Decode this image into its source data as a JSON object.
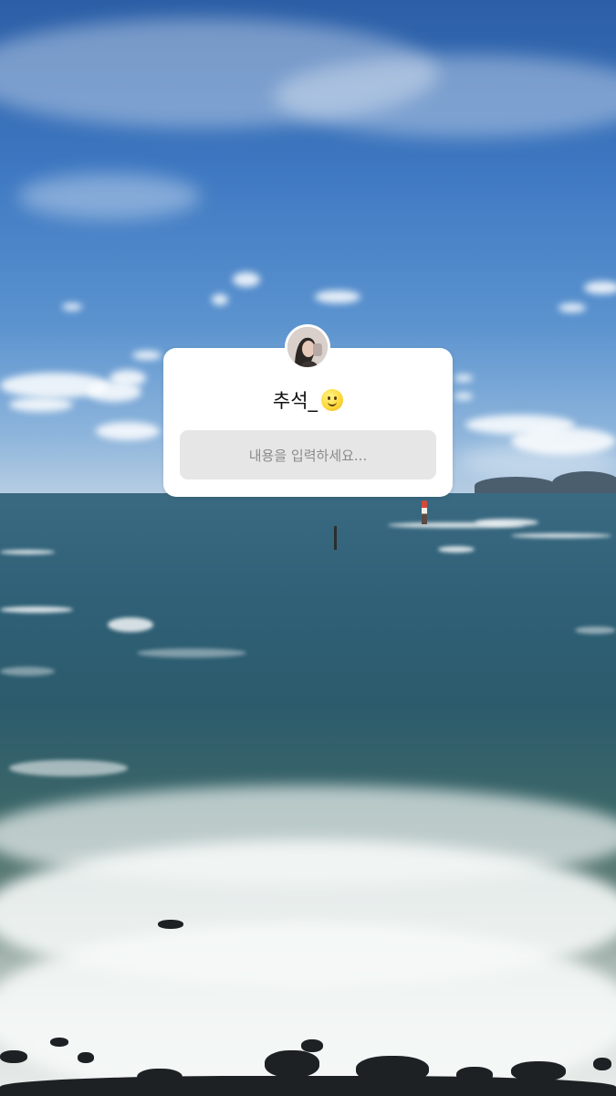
{
  "sticker": {
    "title": "추석_",
    "title_emoji": "slightly-smiling-face-icon",
    "placeholder": "내용을 입력하세요..."
  },
  "colors": {
    "card_background": "#ffffff",
    "input_background": "#e6e6e6",
    "placeholder_text": "#8a8a8a",
    "title_text": "#111111"
  }
}
